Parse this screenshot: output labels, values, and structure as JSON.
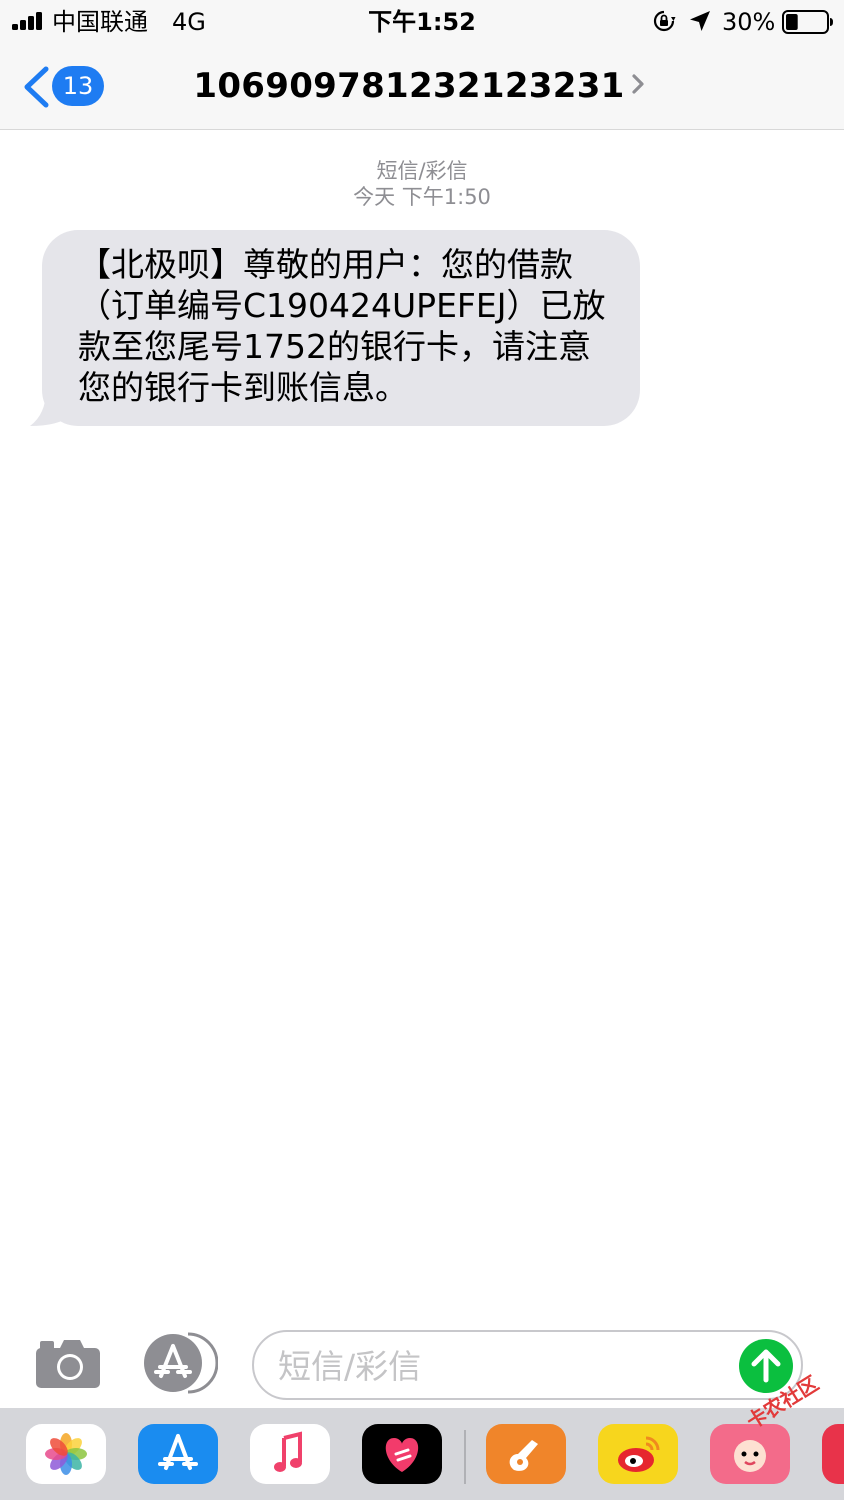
{
  "status_bar": {
    "carrier": "中国联通",
    "network": "4G",
    "time": "下午1:52",
    "battery_percent": "30%",
    "battery_level": 0.3,
    "icons": [
      "signal-icon",
      "orientation-lock-icon",
      "location-arrow-icon",
      "battery-icon"
    ]
  },
  "nav": {
    "back_badge": "13",
    "contact": "106909781232123231"
  },
  "conversation": {
    "kind": "短信/彩信",
    "timestamp": "今天 下午1:50",
    "messages": [
      {
        "line1": "【北极呗】尊敬的用户：您的借款",
        "line2": "（订单编号C190424UPEFEJ）已放",
        "line3": "款至您尾号1752的银行卡，请注意",
        "line4": "您的银行卡到账信息。"
      }
    ],
    "bubble_color": "#e5e5ea"
  },
  "compose": {
    "placeholder": "短信/彩信",
    "value": "",
    "send_color": "#0bbf3f"
  },
  "drawer": {
    "apps": [
      "photos-app-icon",
      "app-store-app-icon",
      "music-app-icon",
      "digital-touch-app-icon",
      "garageband-app-icon",
      "weibo-app-icon",
      "baby-app-icon"
    ]
  },
  "watermark": "卡农社区"
}
